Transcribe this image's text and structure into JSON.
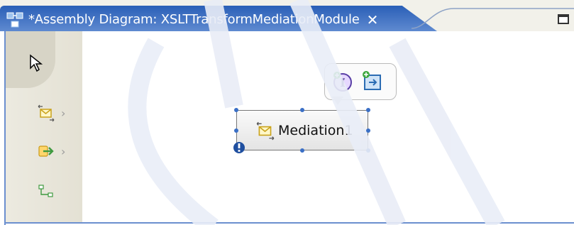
{
  "editor_tab": {
    "title": "*Assembly Diagram: XSLTTransformMediationModule",
    "close_glyph": "✕"
  },
  "palette": {
    "items": [
      {
        "icon": "selection-arrow-icon"
      },
      {
        "icon": "mediation-flow-icon",
        "chevron": "›"
      },
      {
        "icon": "import-icon",
        "chevron": "›"
      },
      {
        "icon": "wire-connection-icon"
      }
    ]
  },
  "node": {
    "label": "Mediation1",
    "icon": "mediation-flow-icon",
    "error_marker": "error-badge-icon"
  },
  "hover_callout": {
    "actions": [
      "add-interface-icon",
      "add-reference-icon"
    ]
  },
  "colors": {
    "tab_active": "#2a5fb7",
    "palette_bg": "#eceae0",
    "handle": "#3a6fc6"
  }
}
